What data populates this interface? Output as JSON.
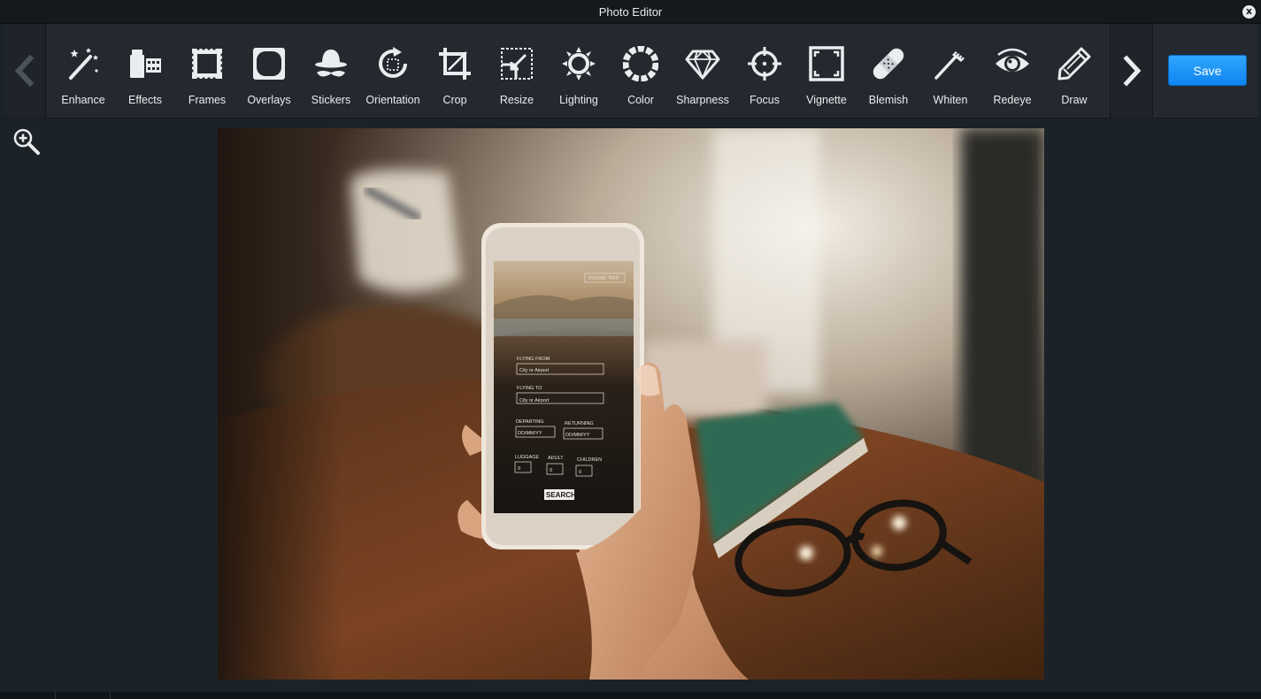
{
  "window": {
    "title": "Photo Editor",
    "close_label": "x"
  },
  "toolbar": {
    "tools": [
      {
        "label": "Enhance",
        "icon": "magic-wand-icon"
      },
      {
        "label": "Effects",
        "icon": "film-icon"
      },
      {
        "label": "Frames",
        "icon": "frame-icon"
      },
      {
        "label": "Overlays",
        "icon": "overlay-icon"
      },
      {
        "label": "Stickers",
        "icon": "mustache-hat-icon"
      },
      {
        "label": "Orientation",
        "icon": "rotate-icon"
      },
      {
        "label": "Crop",
        "icon": "crop-icon"
      },
      {
        "label": "Resize",
        "icon": "resize-icon"
      },
      {
        "label": "Lighting",
        "icon": "sun-icon"
      },
      {
        "label": "Color",
        "icon": "color-wheel-icon"
      },
      {
        "label": "Sharpness",
        "icon": "diamond-icon"
      },
      {
        "label": "Focus",
        "icon": "crosshair-icon"
      },
      {
        "label": "Vignette",
        "icon": "vignette-icon"
      },
      {
        "label": "Blemish",
        "icon": "bandage-icon"
      },
      {
        "label": "Whiten",
        "icon": "brush-icon"
      },
      {
        "label": "Redeye",
        "icon": "eye-icon"
      },
      {
        "label": "Draw",
        "icon": "pencil-icon"
      }
    ],
    "save_label": "Save",
    "prev_icon": "chevron-left-icon",
    "next_icon": "chevron-right-icon"
  },
  "canvas": {
    "zoom_icon": "zoom-in-icon"
  },
  "photo": {
    "form": {
      "badge": "ROUND TRIP",
      "flying_from_label": "FLYING FROM",
      "flying_from_placeholder": "City or Airport",
      "flying_to_label": "FLYING TO",
      "flying_to_placeholder": "City or Airport",
      "departing_label": "DEPARTING",
      "departing_value": "DD/MM/YY",
      "returning_label": "RETURNING",
      "returning_value": "DD/MM/YY",
      "luggage_label": "LUGGAGE",
      "luggage_value": "0",
      "adult_label": "ADULT",
      "adult_value": "0",
      "children_label": "CHILDREN",
      "children_value": "0",
      "search_label": "SEARCH"
    }
  }
}
